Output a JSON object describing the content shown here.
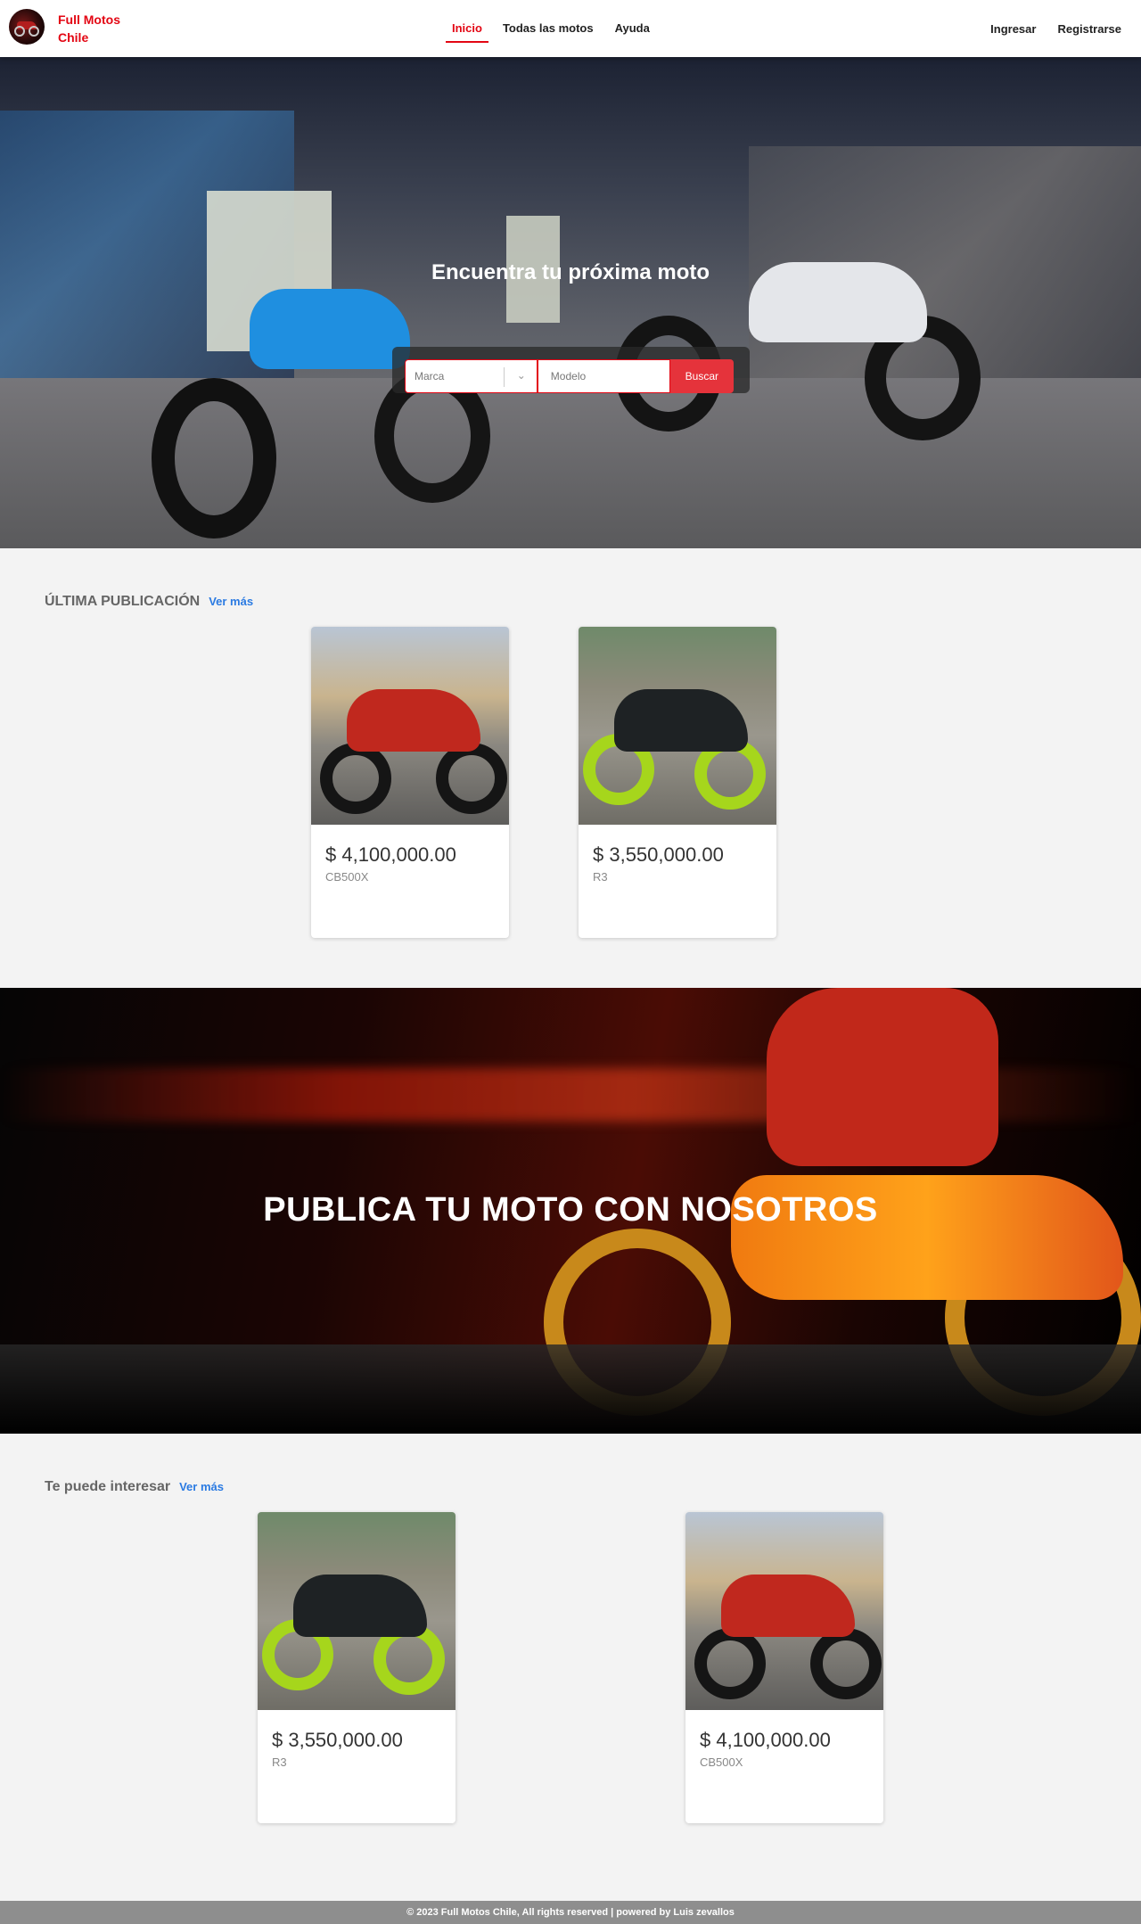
{
  "brand": {
    "name": "Full Motos Chile",
    "accent_color": "#e30613"
  },
  "nav": {
    "items": [
      {
        "label": "Inicio",
        "active": true
      },
      {
        "label": "Todas las motos",
        "active": false
      },
      {
        "label": "Ayuda",
        "active": false
      }
    ],
    "login": "Ingresar",
    "register": "Registrarse"
  },
  "hero": {
    "title": "Encuentra tu próxima moto",
    "brand_select_placeholder": "Marca",
    "model_input_placeholder": "Modelo",
    "search_button": "Buscar"
  },
  "latest": {
    "title": "ÚLTIMA PUBLICACIÓN",
    "more_link": "Ver más",
    "cards": [
      {
        "price": "$ 4,100,000.00",
        "model": "CB500X"
      },
      {
        "price": "$ 3,550,000.00",
        "model": "R3"
      }
    ]
  },
  "promo": {
    "title": "PUBLICA TU MOTO CON NOSOTROS"
  },
  "interest": {
    "title": "Te puede interesar",
    "more_link": "Ver más",
    "cards": [
      {
        "price": "$ 3,550,000.00",
        "model": "R3"
      },
      {
        "price": "$ 4,100,000.00",
        "model": "CB500X"
      }
    ]
  },
  "footer": {
    "text": "© 2023 Full Motos Chile, All rights reserved | powered by Luis zevallos"
  }
}
